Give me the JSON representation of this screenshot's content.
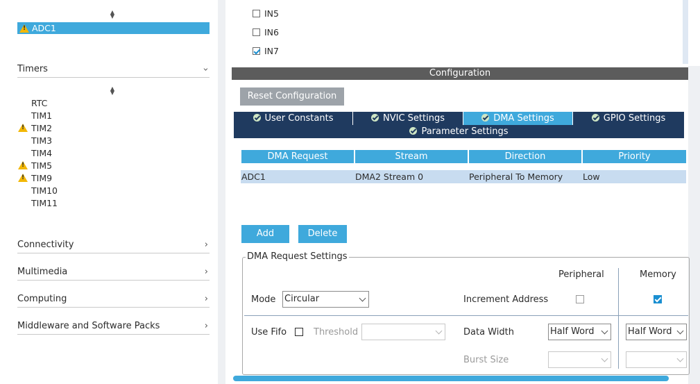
{
  "left": {
    "selected_item": "ADC1",
    "categories": {
      "timers": "Timers",
      "connectivity": "Connectivity",
      "multimedia": "Multimedia",
      "computing": "Computing",
      "middleware": "Middleware and Software Packs"
    },
    "timers": [
      "RTC",
      "TIM1",
      "TIM2",
      "TIM3",
      "TIM4",
      "TIM5",
      "TIM9",
      "TIM10",
      "TIM11"
    ]
  },
  "channels": [
    {
      "label": "IN5",
      "checked": false
    },
    {
      "label": "IN6",
      "checked": false
    },
    {
      "label": "IN7",
      "checked": true
    }
  ],
  "config": {
    "title": "Configuration",
    "reset_button": "Reset Configuration",
    "tabs": [
      "User Constants",
      "NVIC Settings",
      "DMA Settings",
      "GPIO Settings",
      "Parameter Settings"
    ],
    "active_tab": "DMA Settings"
  },
  "dma_table": {
    "headers": [
      "DMA Request",
      "Stream",
      "Direction",
      "Priority"
    ],
    "rows": [
      [
        "ADC1",
        "DMA2 Stream 0",
        "Peripheral To Memory",
        "Low"
      ]
    ]
  },
  "buttons": {
    "add": "Add",
    "delete": "Delete"
  },
  "request_settings": {
    "legend": "DMA Request Settings",
    "peripheral_header": "Peripheral",
    "memory_header": "Memory",
    "mode_label": "Mode",
    "mode_value": "Circular",
    "increment_label": "Increment Address",
    "increment_peripheral": false,
    "increment_memory": true,
    "use_fifo_label": "Use Fifo",
    "use_fifo": false,
    "threshold_label": "Threshold",
    "threshold_value": "",
    "data_width_label": "Data Width",
    "data_width_peripheral": "Half Word",
    "data_width_memory": "Half Word",
    "burst_size_label": "Burst Size",
    "burst_peripheral": "",
    "burst_memory": ""
  },
  "colors": {
    "accent": "#3fa9dc",
    "tab_dark": "#1f3a5f",
    "warning": "#f2b705",
    "header_bar": "#5c5c5c"
  }
}
